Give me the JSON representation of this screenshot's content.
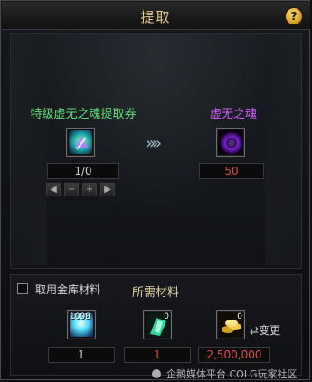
{
  "window": {
    "title": "提取",
    "help_glyph": "?"
  },
  "extract": {
    "input": {
      "label": "特级虚无之魂提取券",
      "count": "1/0",
      "icon": "extraction-voucher-icon",
      "controls": [
        "◀",
        "−",
        "+",
        "▶"
      ]
    },
    "arrows": "»»",
    "output": {
      "label": "虚无之魂",
      "count": "50",
      "icon": "void-soul-icon"
    }
  },
  "materials": {
    "use_vault_label": "取用金库材料",
    "header": "所需材料",
    "items": [
      {
        "icon": "material-orb-icon",
        "badge": "1098",
        "required": "1",
        "required_color": "#c9c9c9"
      },
      {
        "icon": "crystal-shard-icon",
        "badge": "0",
        "required": "1",
        "required_color": "#e04b4b"
      },
      {
        "icon": "gold-coins-icon",
        "badge": "0",
        "required": "2,500,000",
        "required_color": "#e04b4b"
      }
    ],
    "change_label": "变更"
  },
  "watermark": {
    "text": "企鹅媒体平台 COLG玩家社区"
  },
  "colors": {
    "title_gold": "#e6c98c",
    "input_label_green": "#5fe07a",
    "output_label_purple": "#d35cff",
    "panel_bg": "#0f1115"
  }
}
